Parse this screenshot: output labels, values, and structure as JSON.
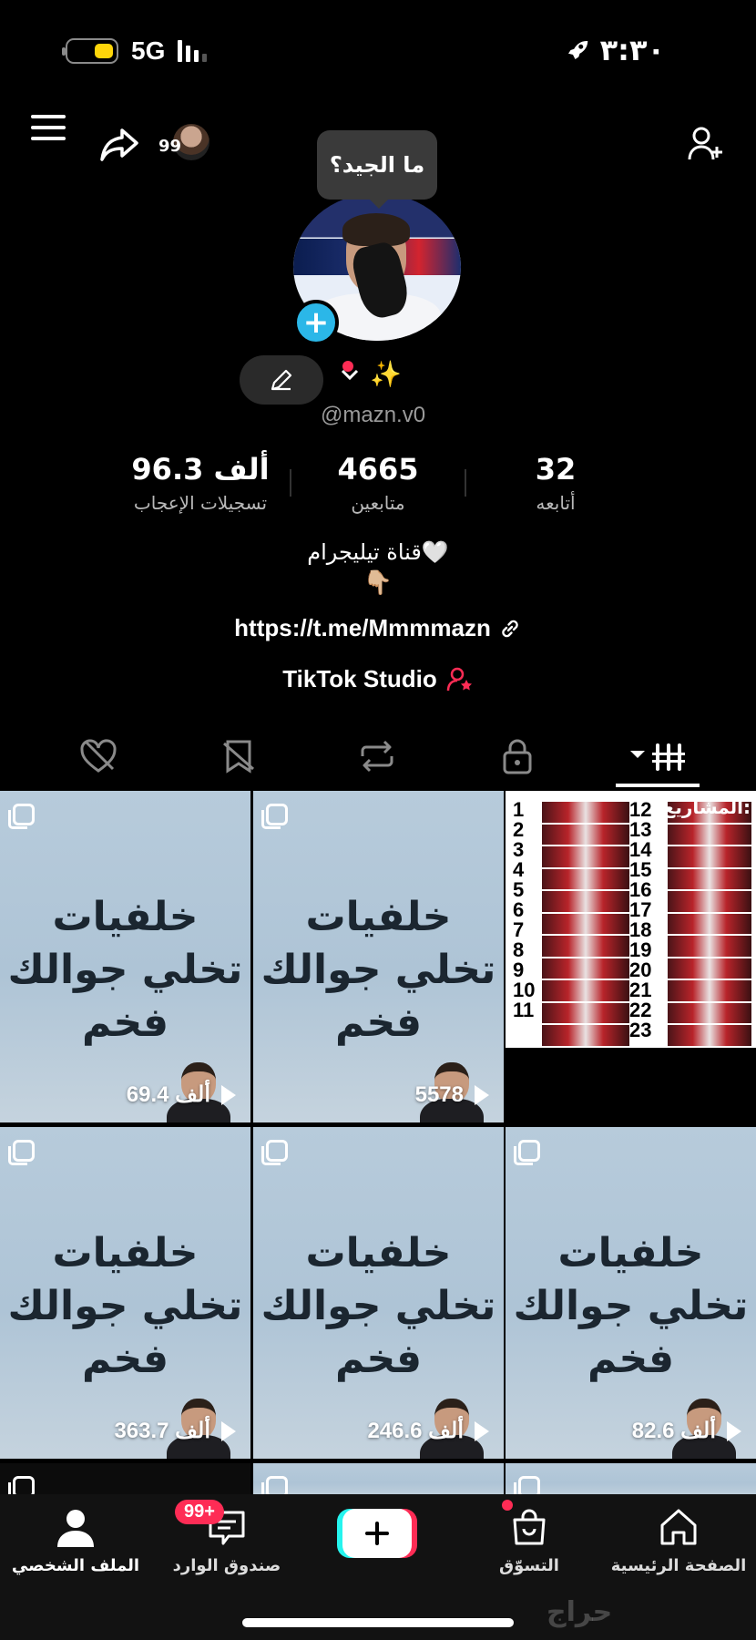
{
  "status_bar": {
    "network": "5G",
    "time": "٣:٣٠",
    "battery_level": 0.4,
    "signal_bars": 3,
    "colors": {
      "battery": "#ffd60a"
    }
  },
  "header": {
    "menu_icon": "menu-icon",
    "share_icon": "share-icon",
    "avatar_count": "99",
    "add_friend_icon": "add-friend-icon"
  },
  "profile": {
    "tooltip": "ما الجيد؟",
    "name": "✨",
    "handle": "@mazn.v0",
    "stats": [
      {
        "value": "96.3 ألف",
        "label": "تسجيلات الإعجاب"
      },
      {
        "value": "4665",
        "label": "متابعين"
      },
      {
        "value": "32",
        "label": "أتابعه"
      }
    ],
    "bio_line1": "قناة تيليجرام🤍",
    "bio_line2": "👇🏼",
    "link": "https://t.me/Mmmmazn",
    "studio": "TikTok Studio"
  },
  "tabs": [
    {
      "name": "liked",
      "icon": "liked-hidden-icon"
    },
    {
      "name": "favorites",
      "icon": "favorites-hidden-icon"
    },
    {
      "name": "reposts",
      "icon": "repost-icon"
    },
    {
      "name": "private",
      "icon": "lock-icon"
    },
    {
      "name": "videos",
      "icon": "grid-icon",
      "active": true
    }
  ],
  "grid": {
    "tile_title": "خلفيات تخلي جوالك فخم",
    "projects_title": "المشاريع:",
    "projects_left_numbers": [
      "1",
      "2",
      "3",
      "4",
      "5",
      "6",
      "7",
      "8",
      "9",
      "10",
      "11"
    ],
    "projects_right_numbers": [
      "12",
      "13",
      "14",
      "15",
      "16",
      "17",
      "18",
      "19",
      "20",
      "21",
      "22",
      "23"
    ],
    "tiles": [
      {
        "views": "69.4 ألف"
      },
      {
        "views": "5578"
      },
      {
        "views": "363.7 ألف"
      },
      {
        "views": "246.6 ألف"
      },
      {
        "views": "82.6 ألف"
      }
    ]
  },
  "bottom_nav": {
    "profile": "الملف الشخصي",
    "inbox": "صندوق الوارد",
    "inbox_badge": "99+",
    "shop": "التسوّق",
    "home": "الصفحة الرئيسية"
  },
  "watermark": "حراج"
}
